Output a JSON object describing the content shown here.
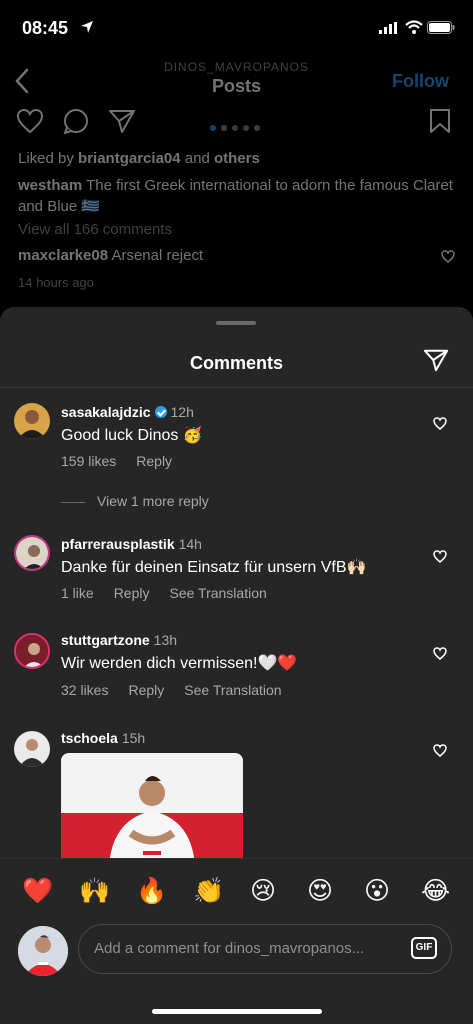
{
  "status": {
    "time": "08:45"
  },
  "header": {
    "username": "DINOS_MAVROPANOS",
    "title": "Posts",
    "follow_label": "Follow"
  },
  "post": {
    "liked_prefix": "Liked by",
    "liked_user": "briantgarcia04",
    "liked_and": "and",
    "liked_others": "others",
    "caption_user": "westham",
    "caption_text": "The first Greek international to adorn the famous Claret and Blue 🇬🇷",
    "view_comments": "View all 166 comments",
    "preview_user": "maxclarke08",
    "preview_text": "Arsenal reject",
    "timestamp": "14 hours ago"
  },
  "sheet": {
    "title": "Comments",
    "comments": [
      {
        "user": "sasakalajdzic",
        "time": "12h",
        "text": "Good luck Dinos 🥳",
        "likes": "159 likes",
        "reply": "Reply",
        "view_more": "View 1 more reply"
      },
      {
        "user": "pfarrerausplastik",
        "time": "14h",
        "text": "Danke für deinen Einsatz für unsern VfB🙌🏻",
        "likes": "1 like",
        "reply": "Reply",
        "translate": "See Translation"
      },
      {
        "user": "stuttgartzone",
        "time": "13h",
        "text": "Wir werden dich vermissen!🤍❤️",
        "likes": "32 likes",
        "reply": "Reply",
        "translate": "See Translation"
      },
      {
        "user": "tschoela",
        "time": "15h"
      }
    ]
  },
  "emojis": [
    "❤️",
    "🙌",
    "🔥",
    "👏",
    "😢",
    "😍",
    "😮",
    "😂"
  ],
  "composer": {
    "placeholder": "Add a comment for dinos_mavropanos...",
    "gif_label": "GIF"
  }
}
